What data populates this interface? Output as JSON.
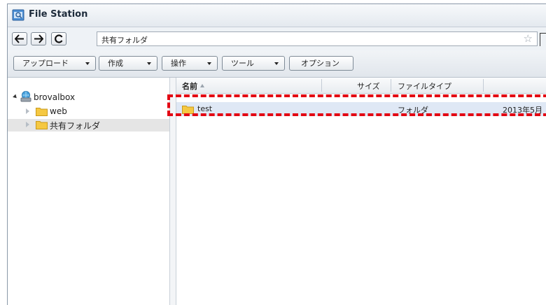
{
  "window": {
    "title": "File Station"
  },
  "nav": {
    "path": "共有フォルダ"
  },
  "toolbar": {
    "buttons": [
      "アップロード",
      "作成",
      "操作",
      "ツール"
    ],
    "option": "オプション"
  },
  "tree": {
    "root": "brovalbox",
    "items": [
      "web",
      "共有フォルダ"
    ],
    "selected": "共有フォルダ"
  },
  "list": {
    "columns": [
      "名前",
      "サイズ",
      "ファイルタイプ"
    ],
    "rows": [
      {
        "name": "test",
        "size": "",
        "type": "フォルダ",
        "modified": "2013年5月"
      }
    ]
  },
  "colors": {
    "highlight_border": "#e30613",
    "selection_row": "#dfe8f5",
    "folder": "#f5c842"
  }
}
